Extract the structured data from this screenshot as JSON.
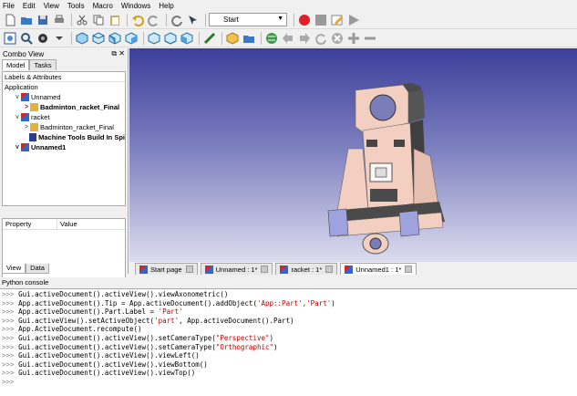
{
  "menu": [
    "File",
    "Edit",
    "View",
    "Tools",
    "Macro",
    "Windows",
    "Help"
  ],
  "workbench": {
    "selected": "Start"
  },
  "combo": {
    "title": "Combo View",
    "tabs": [
      "Model",
      "Tasks"
    ],
    "tree_header": "Labels & Attributes",
    "tree": [
      {
        "label": "Application",
        "indent": 0,
        "bold": false,
        "twisty": ""
      },
      {
        "label": "Unnamed",
        "indent": 1,
        "bold": false,
        "twisty": "v"
      },
      {
        "label": "Badminton_racket_Final",
        "indent": 2,
        "bold": true,
        "twisty": ">"
      },
      {
        "label": "racket",
        "indent": 1,
        "bold": false,
        "twisty": "v"
      },
      {
        "label": "Badminton_racket_Final",
        "indent": 2,
        "bold": false,
        "twisty": ">"
      },
      {
        "label": "Machine Tools Build In Spi",
        "indent": 2,
        "bold": true,
        "twisty": ""
      },
      {
        "label": "Unnamed1",
        "indent": 1,
        "bold": true,
        "twisty": "v"
      }
    ],
    "prop_cols": [
      "Property",
      "Value"
    ],
    "bottom_tabs": [
      "View",
      "Data"
    ]
  },
  "doc_tabs": [
    {
      "label": "Start page",
      "active": false
    },
    {
      "label": "Unnamed : 1*",
      "active": false
    },
    {
      "label": "racket : 1*",
      "active": false
    },
    {
      "label": "Unnamed1 : 1*",
      "active": true
    }
  ],
  "console": {
    "title": "Python console",
    "lines": [
      [
        ">>> ",
        "Gui.activeDocument().activeView().viewAxonometric()",
        "",
        ""
      ],
      [
        ">>> ",
        "App.activeDocument().Tip = App.activeDocument().addObject(",
        "'App::Part','Part'",
        ")"
      ],
      [
        ">>> ",
        "App.activeDocument().Part.Label = ",
        "'Part'",
        ""
      ],
      [
        ">>> ",
        "Gui.activeView().setActiveObject(",
        "'part'",
        ", App.activeDocument().Part)"
      ],
      [
        ">>> ",
        "App.ActiveDocument.recompute()",
        "",
        ""
      ],
      [
        ">>> ",
        "Gui.activeDocument().activeView().setCameraType(",
        "\"Perspective\"",
        ")"
      ],
      [
        ">>> ",
        "Gui.activeDocument().activeView().setCameraType(",
        "\"Orthographic\"",
        ")"
      ],
      [
        ">>> ",
        "Gui.activeDocument().activeView().viewLeft()",
        "",
        ""
      ],
      [
        ">>> ",
        "Gui.activeDocument().activeView().viewBottom()",
        "",
        ""
      ],
      [
        ">>> ",
        "Gui.activeDocument().activeView().viewTop()",
        "",
        ""
      ],
      [
        ">>> ",
        "",
        "",
        ""
      ]
    ]
  },
  "colors": {
    "record": "#e0202a",
    "model": "#f2cfc0",
    "model_dark": "#4a4a4a",
    "fixture": "#9ea3e0"
  }
}
